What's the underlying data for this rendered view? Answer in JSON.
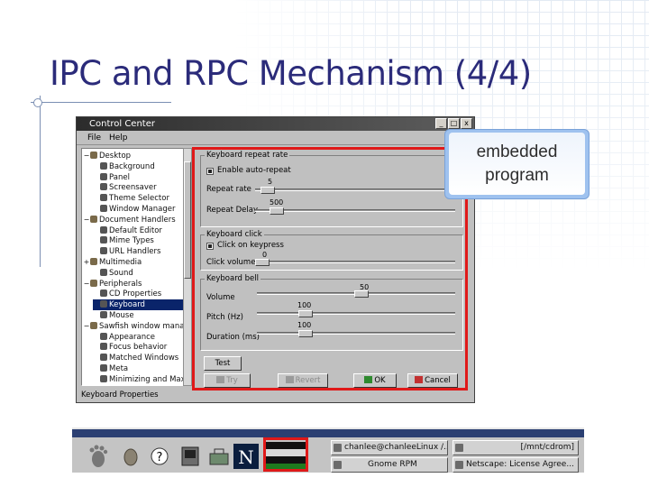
{
  "slide": {
    "title": "IPC and RPC Mechanism (4/4)",
    "callout": "embedded\nprogram",
    "accent": "#2b2b7a",
    "highlight": "#e01919"
  },
  "window": {
    "title": "Control Center",
    "controls": [
      "_",
      "□",
      "x"
    ],
    "menu": [
      "File",
      "Help"
    ],
    "tree": [
      {
        "label": "Desktop",
        "depth": 0,
        "expander": "−",
        "icon": "folder-icon"
      },
      {
        "label": "Background",
        "depth": 1,
        "icon": "gear-icon"
      },
      {
        "label": "Panel",
        "depth": 1,
        "icon": "gear-icon"
      },
      {
        "label": "Screensaver",
        "depth": 1,
        "icon": "gear-icon"
      },
      {
        "label": "Theme Selector",
        "depth": 1,
        "icon": "gear-icon"
      },
      {
        "label": "Window Manager",
        "depth": 1,
        "icon": "gear-icon"
      },
      {
        "label": "Document Handlers",
        "depth": 0,
        "expander": "−",
        "icon": "folder-icon"
      },
      {
        "label": "Default Editor",
        "depth": 1,
        "icon": "gear-icon"
      },
      {
        "label": "Mime Types",
        "depth": 1,
        "icon": "gear-icon"
      },
      {
        "label": "URL Handlers",
        "depth": 1,
        "icon": "gear-icon"
      },
      {
        "label": "Multimedia",
        "depth": 0,
        "expander": "+",
        "icon": "folder-icon"
      },
      {
        "label": "Sound",
        "depth": 1,
        "icon": "gear-icon"
      },
      {
        "label": "Peripherals",
        "depth": 0,
        "expander": "−",
        "icon": "folder-icon"
      },
      {
        "label": "CD Properties",
        "depth": 1,
        "icon": "gear-icon"
      },
      {
        "label": "Keyboard",
        "depth": 1,
        "icon": "gear-icon",
        "selected": true
      },
      {
        "label": "Mouse",
        "depth": 1,
        "icon": "gear-icon"
      },
      {
        "label": "Sawfish window manager",
        "depth": 0,
        "expander": "−",
        "icon": "folder-icon"
      },
      {
        "label": "Appearance",
        "depth": 1,
        "icon": "gear-icon"
      },
      {
        "label": "Focus behavior",
        "depth": 1,
        "icon": "gear-icon"
      },
      {
        "label": "Matched Windows",
        "depth": 1,
        "icon": "gear-icon"
      },
      {
        "label": "Meta",
        "depth": 1,
        "icon": "gear-icon"
      },
      {
        "label": "Minimizing and Max",
        "depth": 1,
        "icon": "gear-icon"
      }
    ],
    "status": "Keyboard Properties"
  },
  "keyboard": {
    "repeat_group": "Keyboard repeat rate",
    "enable_autorepeat": "Enable auto-repeat",
    "repeat_rate_label": "Repeat rate",
    "repeat_rate_value": "5",
    "repeat_delay_label": "Repeat Delay",
    "repeat_delay_value": "500",
    "click_group": "Keyboard click",
    "click_on_keypress": "Click on keypress",
    "click_volume_label": "Click volume",
    "click_volume_value": "0",
    "bell_group": "Keyboard bell",
    "volume_label": "Volume",
    "volume_value": "50",
    "pitch_label": "Pitch (Hz)",
    "pitch_value": "100",
    "duration_label": "Duration (ms)",
    "duration_value": "100",
    "test_button": "Test",
    "buttons": {
      "try": "Try",
      "revert": "Revert",
      "ok": "OK",
      "cancel": "Cancel"
    }
  },
  "taskbar": {
    "launchers": [
      "gnome-foot-icon",
      "mouse-icon",
      "help-icon",
      "terminal-icon",
      "toolbox-icon",
      "netscape-icon",
      "pager-icon"
    ],
    "pager_colors": [
      "#111111",
      "#d9d9d9",
      "#111111",
      "#1e7a1e"
    ],
    "tasks": [
      "chanlee@chanleeLinux /...",
      "[/mnt/cdrom]",
      "Gnome RPM",
      "Netscape: License Agree..."
    ]
  }
}
